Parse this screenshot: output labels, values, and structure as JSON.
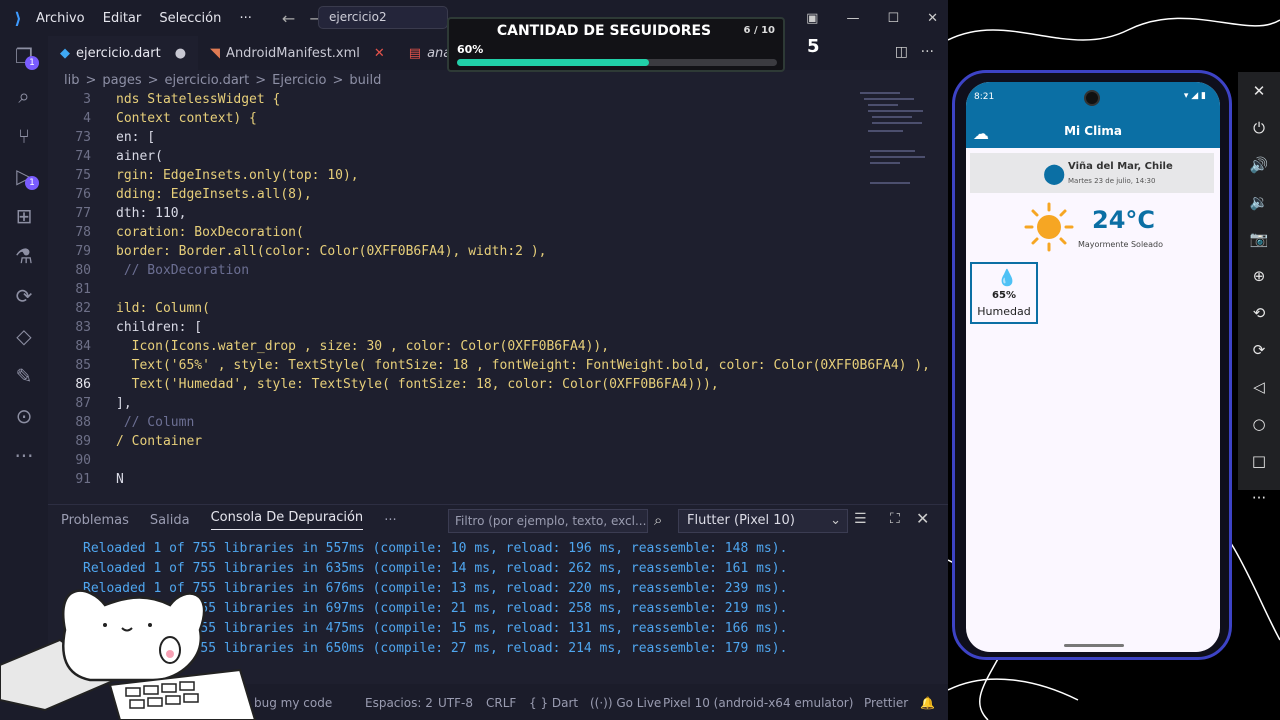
{
  "titlebar": {
    "logo": "vscode-logo",
    "menu": [
      "Archivo",
      "Editar",
      "Selección",
      "···"
    ],
    "search": "ejercicio2"
  },
  "tabs": [
    {
      "label": "ejercicio.dart",
      "icon": "dart-icon"
    },
    {
      "label": "AndroidManifest.xml",
      "icon": "xml-icon"
    },
    {
      "label": "analysis_op",
      "icon": "pdf-icon"
    }
  ],
  "breadcrumbs": [
    "lib",
    ">",
    "pages",
    ">",
    "ejercicio.dart",
    ">",
    "Ejercicio",
    ">",
    "build"
  ],
  "editor": {
    "lines": [
      {
        "n": "3",
        "t": "nds StatelessWidget {"
      },
      {
        "n": "4",
        "t": "Context context) {"
      },
      {
        "n": "73",
        "t": "en: ["
      },
      {
        "n": "74",
        "t": "ainer("
      },
      {
        "n": "75",
        "t": "rgin: EdgeInsets.only(top: 10),"
      },
      {
        "n": "76",
        "t": "dding: EdgeInsets.all(8),"
      },
      {
        "n": "77",
        "t": "dth: 110,"
      },
      {
        "n": "78",
        "t": "coration: BoxDecoration("
      },
      {
        "n": "79",
        "t": "border: Border.all(color: Color(0XFF0B6FA4), width:2 ),"
      },
      {
        "n": "80",
        "t": " // BoxDecoration"
      },
      {
        "n": "81",
        "t": ""
      },
      {
        "n": "82",
        "t": "ild: Column("
      },
      {
        "n": "83",
        "t": "children: ["
      },
      {
        "n": "84",
        "t": "  Icon(Icons.water_drop , size: 30 , color: Color(0XFF0B6FA4)),"
      },
      {
        "n": "85",
        "t": "  Text('65%' , style: TextStyle( fontSize: 18 , fontWeight: FontWeight.bold, color: Color(0XFF0B6FA4) ),"
      },
      {
        "n": "86",
        "t": "  Text('Humedad', style: TextStyle( fontSize: 18, color: Color(0XFF0B6FA4))),"
      },
      {
        "n": "87",
        "t": "],"
      },
      {
        "n": "88",
        "t": " // Column"
      },
      {
        "n": "89",
        "t": "/ Container"
      },
      {
        "n": "90",
        "t": ""
      },
      {
        "n": "91",
        "t": "N"
      }
    ]
  },
  "panel": {
    "tabs": [
      "Problemas",
      "Salida",
      "Consola De Depuración",
      "···"
    ],
    "filter_placeholder": "Filtro (por ejemplo, texto, excl...",
    "device_select": "Flutter (Pixel 10)",
    "logs": [
      "Reloaded 1 of 755 libraries in 557ms (compile: 10 ms, reload: 196 ms, reassemble: 148 ms).",
      "Reloaded 1 of 755 libraries in 635ms (compile: 14 ms, reload: 262 ms, reassemble: 161 ms).",
      "Reloaded 1 of 755 libraries in 676ms (compile: 13 ms, reload: 220 ms, reassemble: 239 ms).",
      "Reloaded 1 of 755 libraries in 697ms (compile: 21 ms, reload: 258 ms, reassemble: 219 ms).",
      "Reloaded 1 of 755 libraries in 475ms (compile: 15 ms, reload: 131 ms, reassemble: 166 ms).",
      "Reloaded 1 of 755 libraries in 650ms (compile: 27 ms, reload: 214 ms, reassemble: 179 ms)."
    ]
  },
  "statusbar": {
    "debug": "bug my code",
    "spaces": "Espacios: 2",
    "encoding": "UTF-8",
    "eol": "CRLF",
    "lang": "{ } Dart",
    "golive": "((·)) Go Live",
    "device": "Pixel 10 (android-x64 emulator)",
    "prettier": "Prettier"
  },
  "overlay": {
    "title": "CANTIDAD DE SEGUIDORES",
    "count": "6 / 10",
    "percent_text": "60%",
    "progress": 0.6,
    "badge_num": "5"
  },
  "phone": {
    "time": "8:21",
    "app_title": "Mi Clima",
    "city": "Viña del Mar, Chile",
    "date": "Martes 23 de julio, 14:30",
    "temp": "24°C",
    "desc": "Mayormente Soleado",
    "humidity_value": "65%",
    "humidity_label": "Humedad"
  },
  "colors": {
    "accent": "#0b6fa4",
    "progress": "#21d0a8",
    "phone_frame": "#3d43c6"
  }
}
